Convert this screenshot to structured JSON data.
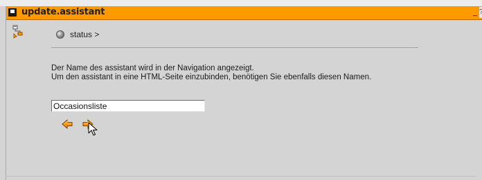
{
  "window": {
    "title": "update.assistant",
    "minimize_glyph": "_",
    "help_glyph": "?"
  },
  "breadcrumb": {
    "label": "status >"
  },
  "description": {
    "line1": "Der Name des assistant wird in der Navigation angezeigt.",
    "line2": "Um den assistant in eine HTML-Seite einzubinden, benötigen Sie ebenfalls diesen Namen."
  },
  "name_input": {
    "value": "Occasionsliste"
  },
  "icons": {
    "window": "window-icon",
    "sidebar": "assistant-hierarchy-icon",
    "status": "status-ball-icon",
    "back": "arrow-left-icon",
    "next": "arrow-right-icon",
    "cursor": "mouse-pointer-icon"
  },
  "colors": {
    "titlebar": "#ff9900",
    "background": "#d4d4d4",
    "arrow_fill": "#ff9900"
  }
}
